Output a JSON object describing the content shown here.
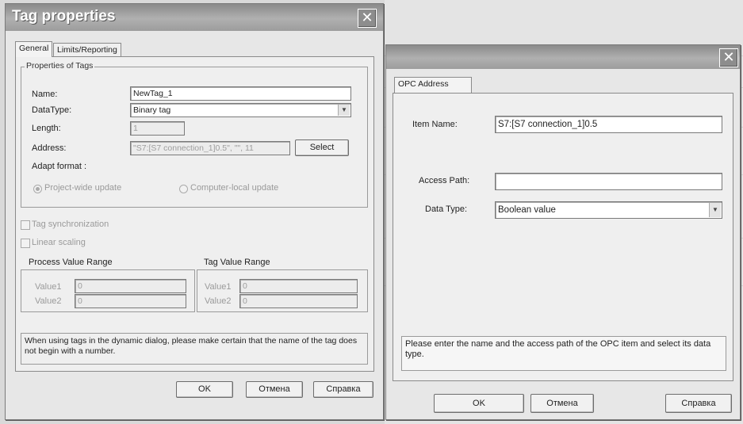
{
  "tag_dialog": {
    "title": "Tag properties",
    "close_glyph": "✕",
    "tabs": [
      "General",
      "Limits/Reporting"
    ],
    "properties_group": "Properties of Tags",
    "name_label": "Name:",
    "name_value": "NewTag_1",
    "datatype_label": "DataType:",
    "datatype_value": "Binary tag",
    "length_label": "Length:",
    "length_value": "1",
    "address_label": "Address:",
    "address_value": "\"S7:[S7 connection_1]0.5\", \"\", 11",
    "select_button": "Select",
    "adapt_format_label": "Adapt format :",
    "radio_project": "Project-wide update",
    "radio_computer": "Computer-local update",
    "tag_sync_label": "Tag synchronization",
    "linear_scaling_label": "Linear scaling",
    "process_range_label": "Process Value Range",
    "tag_range_label": "Tag Value Range",
    "value1_label": "Value1",
    "value2_label": "Value2",
    "pv_value1": "0",
    "pv_value2": "0",
    "tv_value1": "0",
    "tv_value2": "0",
    "hint": "When using tags in the dynamic dialog, please make certain that the name of the tag does not begin with a number.",
    "ok_button": "OK",
    "cancel_button": "Отмена",
    "help_button": "Справка"
  },
  "opc_dialog": {
    "close_glyph": "✕",
    "tab": "OPC Address",
    "item_name_label": "Item Name:",
    "item_name_value": "S7:[S7 connection_1]0.5",
    "access_path_label": "Access Path:",
    "access_path_value": "",
    "data_type_label": "Data Type:",
    "data_type_value": "Boolean value",
    "hint": "Please enter the name and the access path of the OPC item and select its data type.",
    "ok_button": "OK",
    "cancel_button": "Отмена",
    "help_button": "Справка"
  }
}
